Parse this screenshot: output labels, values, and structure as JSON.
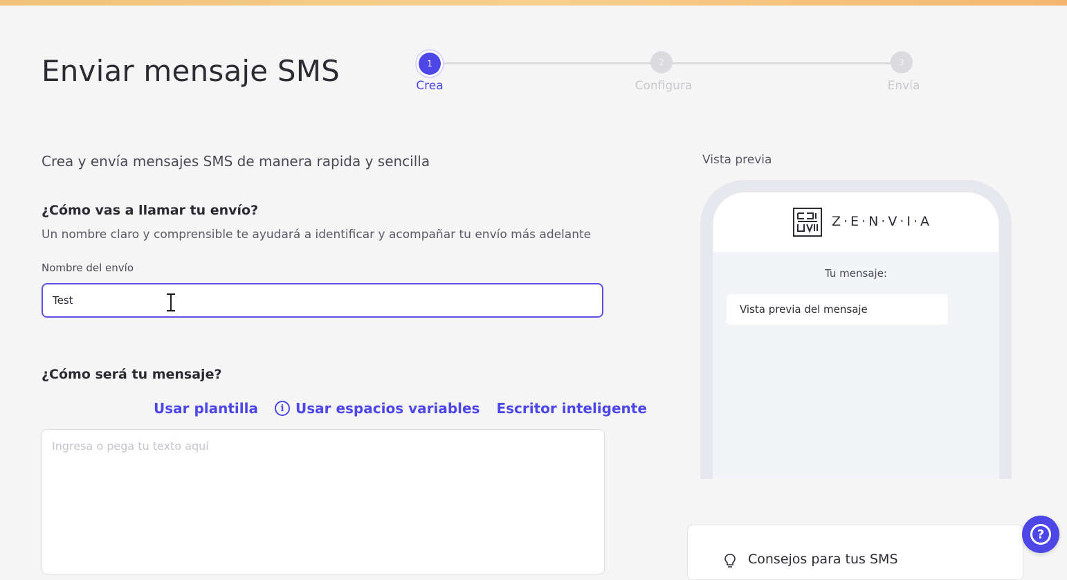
{
  "page": {
    "title": "Enviar mensaje SMS",
    "subtitle": "Crea y envía mensajes SMS de manera rapida y sencilla"
  },
  "stepper": {
    "steps": [
      {
        "number": "1",
        "label": "Crea",
        "state": "active"
      },
      {
        "number": "2",
        "label": "Configura",
        "state": "inactive"
      },
      {
        "number": "3",
        "label": "Envía",
        "state": "inactive"
      }
    ]
  },
  "name_section": {
    "question": "¿Cómo vas a llamar tu envío?",
    "help": "Un nombre claro y comprensible te ayudará a identificar y acompañar tu envío más adelante",
    "field_label": "Nombre del envío",
    "field_value": "Test"
  },
  "message_section": {
    "question": "¿Cómo será tu mensaje?",
    "tools": {
      "template": "Usar plantilla",
      "variables": "Usar espacios variables",
      "smart_writer": "Escritor inteligente"
    },
    "placeholder": "Ingresa o pega tu texto aquí"
  },
  "preview": {
    "label": "Vista previa",
    "brand": "Z·E·N·V·I·A",
    "your_message": "Tu mensaje:",
    "bubble_text": "Vista previa del mensaje"
  },
  "tips": {
    "title": "Consejos para tus SMS"
  },
  "colors": {
    "accent": "#4e47e8",
    "inactive": "#dadadf"
  },
  "icons": {
    "cursor": "text-cursor-icon",
    "info": "info-icon",
    "tips": "lightbulb-icon",
    "help": "question-icon"
  }
}
